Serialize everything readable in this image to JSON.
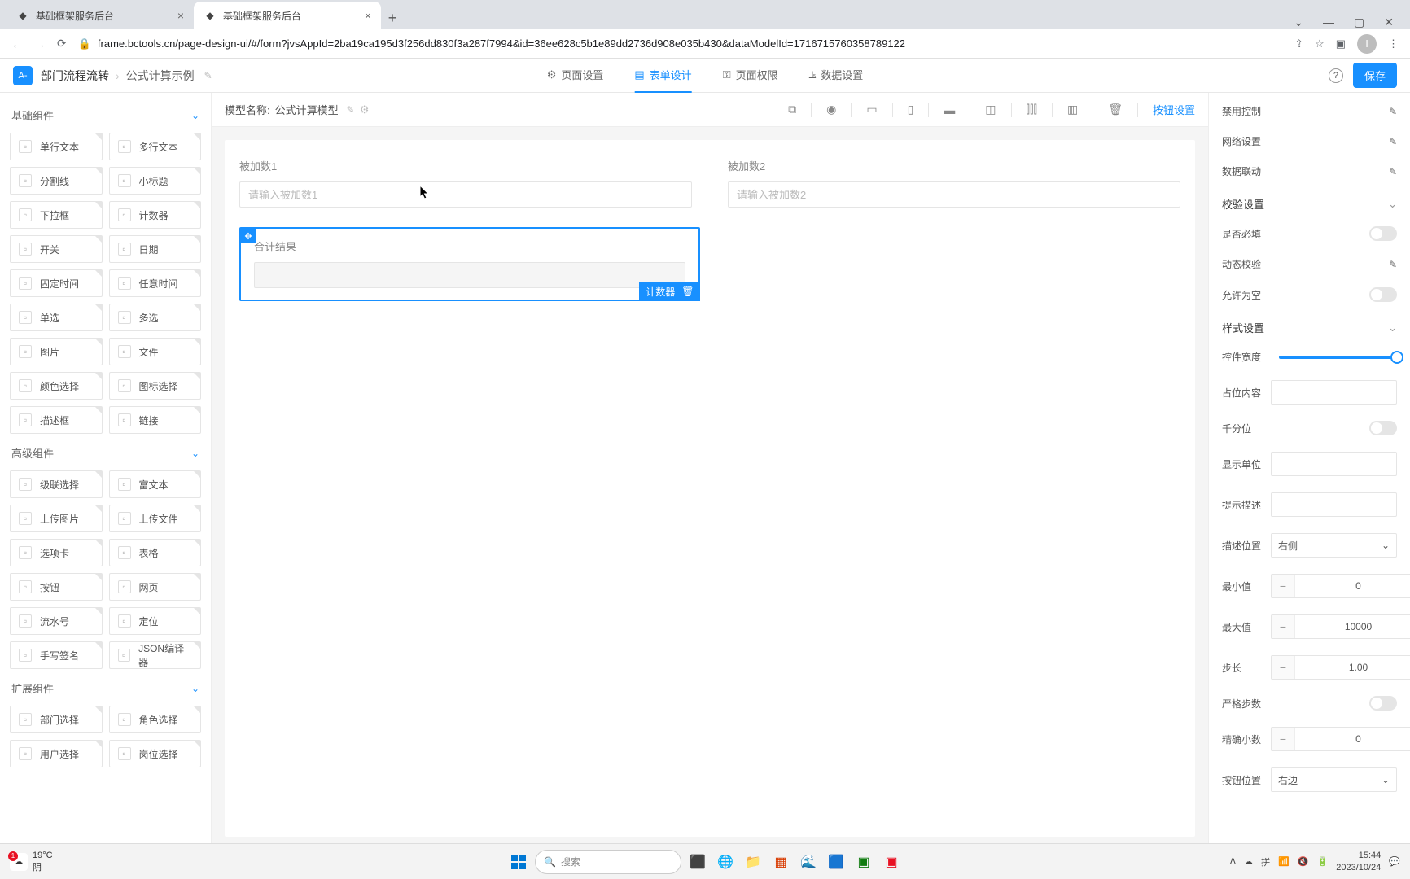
{
  "tabs": [
    {
      "title": "基础框架服务后台",
      "active": false
    },
    {
      "title": "基础框架服务后台",
      "active": true
    }
  ],
  "url": "frame.bctools.cn/page-design-ui/#/form?jvsAppId=2ba19ca195d3f256dd830f3a287f7994&id=36ee628c5b1e89dd2736d908e035b430&dataModelId=1716715760358789122",
  "avatar": "I",
  "breadcrumb": {
    "root": "部门流程流转",
    "item": "公式计算示例"
  },
  "centerTabs": {
    "page": "页面设置",
    "form": "表单设计",
    "perm": "页面权限",
    "data": "数据设置"
  },
  "saveBtn": "保存",
  "modelLabel": "模型名称:",
  "modelName": "公式计算模型",
  "buttonSettings": "按钮设置",
  "leftGroups": {
    "basic": "基础组件",
    "advanced": "高级组件",
    "extend": "扩展组件"
  },
  "basicComps": [
    "单行文本",
    "多行文本",
    "分割线",
    "小标题",
    "下拉框",
    "计数器",
    "开关",
    "日期",
    "固定时间",
    "任意时间",
    "单选",
    "多选",
    "图片",
    "文件",
    "颜色选择",
    "图标选择",
    "描述框",
    "链接"
  ],
  "advComps": [
    "级联选择",
    "富文本",
    "上传图片",
    "上传文件",
    "选项卡",
    "表格",
    "按钮",
    "网页",
    "流水号",
    "定位",
    "手写签名",
    "JSON编译器"
  ],
  "extComps": [
    "部门选择",
    "角色选择",
    "用户选择",
    "岗位选择"
  ],
  "fields": {
    "f1": {
      "label": "被加数1",
      "placeholder": "请输入被加数1"
    },
    "f2": {
      "label": "被加数2",
      "placeholder": "请输入被加数2"
    },
    "f3": {
      "label": "合计结果",
      "tag": "计数器"
    }
  },
  "rightPanel": {
    "disableControl": "禁用控制",
    "networkSettings": "网络设置",
    "dataLinkage": "数据联动",
    "validation": "校验设置",
    "required": "是否必填",
    "dynamicValidation": "动态校验",
    "allowEmpty": "允许为空",
    "styleSettings": "样式设置",
    "widgetWidth": "控件宽度",
    "placeholder": "占位内容",
    "thousands": "千分位",
    "displayUnit": "显示单位",
    "hintDesc": "提示描述",
    "descPosition": "描述位置",
    "descPosVal": "右侧",
    "min": "最小值",
    "minVal": "0",
    "max": "最大值",
    "maxVal": "10000",
    "step": "步长",
    "stepVal": "1.00",
    "strictStep": "严格步数",
    "precision": "精确小数",
    "precisionVal": "0",
    "btnPos": "按钮位置",
    "btnPosVal": "右边"
  },
  "taskbar": {
    "temp": "19°C",
    "cond": "阴",
    "search": "搜索",
    "time": "15:44",
    "date": "2023/10/24"
  }
}
